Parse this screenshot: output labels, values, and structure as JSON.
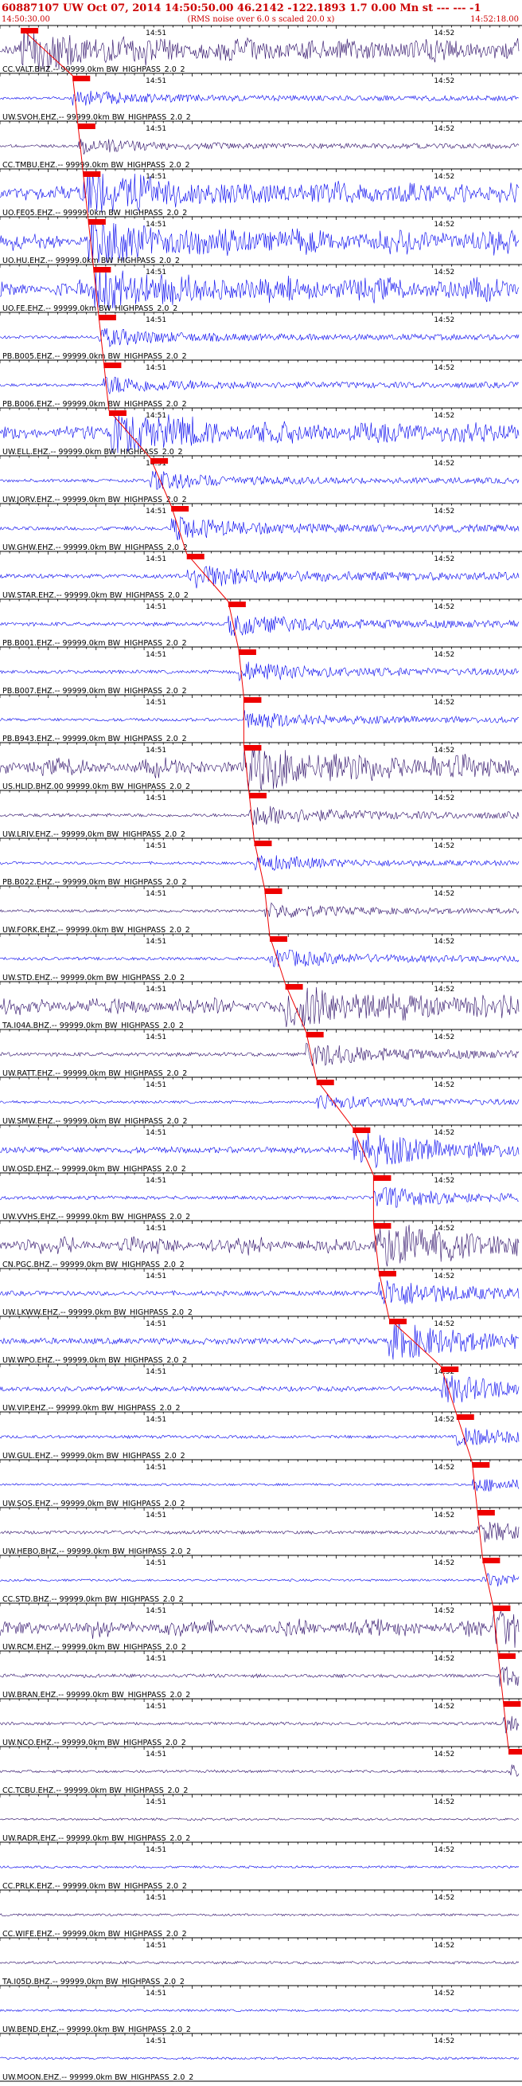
{
  "header": {
    "title": "60887107 UW Oct 07, 2014 14:50:50.00   46.2142 -122.1893  1.7 0.00 Mn st --- --- -1",
    "start_time": "14:50:30.00",
    "rms_note": "(RMS noise over 6.0 s scaled 20.0 x)",
    "end_time": "14:52:18.00"
  },
  "colors": {
    "trace_a": "#0000ee",
    "trace_b": "#2a0a66",
    "pick": "#ee0000",
    "axis": "#000000",
    "background": "#ffffff"
  },
  "chart_data": {
    "type": "line",
    "title": "60887107 UW Oct 07, 2014 14:50:50.00   46.2142 -122.1893  1.7 0.00 Mn st --- --- -1",
    "x_range": [
      "14:50:30.00",
      "14:52:18.00"
    ],
    "x_tick_labels": [
      "14:51",
      "14:52"
    ],
    "filter_note": "(RMS noise over 6.0 s scaled 20.0 x)",
    "series": [
      {
        "name": "CC.VALT.BHZ.--",
        "label": "CC.VALT.BHZ.-- 99999.0km BW_HIGHPASS_2.0_2",
        "pick": 0.04,
        "amp": 0.9,
        "color": "trace_b"
      },
      {
        "name": "UW.SVOH.EHZ.--",
        "label": "UW.SVOH.EHZ.-- 99999.0km BW_HIGHPASS_2.0_2",
        "pick": 0.14,
        "amp": 0.35,
        "color": "trace_a"
      },
      {
        "name": "CC.TMBU.EHZ.--",
        "label": "CC.TMBU.EHZ.-- 99999.0km BW_HIGHPASS_2.0_2",
        "pick": 0.15,
        "amp": 0.35,
        "color": "trace_b"
      },
      {
        "name": "UO.FE05.EHZ.--",
        "label": "UO.FE05.EHZ.-- 99999.0km BW_HIGHPASS_2.0_2",
        "pick": 0.16,
        "amp": 0.9,
        "color": "trace_a"
      },
      {
        "name": "UO.HU.EHZ.--",
        "label": "UO.HU.EHZ.-- 99999.0km BW_HIGHPASS_2.0_2",
        "pick": 0.17,
        "amp": 0.95,
        "color": "trace_a"
      },
      {
        "name": "UO.FE.EHZ.--",
        "label": "UO.FE.EHZ.-- 99999.0km BW_HIGHPASS_2.0_2",
        "pick": 0.18,
        "amp": 0.9,
        "color": "trace_a"
      },
      {
        "name": "PB.B005.EHZ.--",
        "label": "PB.B005.EHZ.-- 99999.0km BW_HIGHPASS_2.0_2",
        "pick": 0.19,
        "amp": 0.4,
        "color": "trace_a"
      },
      {
        "name": "PB.B006.EHZ.--",
        "label": "PB.B006.EHZ.-- 99999.0km BW_HIGHPASS_2.0_2",
        "pick": 0.2,
        "amp": 0.4,
        "color": "trace_a"
      },
      {
        "name": "UW.ELL.EHZ.--",
        "label": "UW.ELL.EHZ.-- 99999.0km BW_HIGHPASS_2.0_2",
        "pick": 0.21,
        "amp": 0.85,
        "color": "trace_a"
      },
      {
        "name": "UW.JORV.EHZ.--",
        "label": "UW.JORV.EHZ.-- 99999.0km BW_HIGHPASS_2.0_2",
        "pick": 0.29,
        "amp": 0.4,
        "color": "trace_a"
      },
      {
        "name": "UW.GHW.EHZ.--",
        "label": "UW.GHW.EHZ.-- 99999.0km BW_HIGHPASS_2.0_2",
        "pick": 0.33,
        "amp": 0.5,
        "color": "trace_a"
      },
      {
        "name": "UW.STAR.EHZ.--",
        "label": "UW.STAR.EHZ.-- 99999.0km BW_HIGHPASS_2.0_2",
        "pick": 0.36,
        "amp": 0.55,
        "color": "trace_a"
      },
      {
        "name": "PB.B001.EHZ.--",
        "label": "PB.B001.EHZ.-- 99999.0km BW_HIGHPASS_2.0_2",
        "pick": 0.44,
        "amp": 0.5,
        "color": "trace_a"
      },
      {
        "name": "PB.B007.EHZ.--",
        "label": "PB.B007.EHZ.-- 99999.0km BW_HIGHPASS_2.0_2",
        "pick": 0.46,
        "amp": 0.45,
        "color": "trace_a"
      },
      {
        "name": "PB.B943.EHZ.--",
        "label": "PB.B943.EHZ.-- 99999.0km BW_HIGHPASS_2.0_2",
        "pick": 0.47,
        "amp": 0.4,
        "color": "trace_a"
      },
      {
        "name": "US.HLID.BHZ.00",
        "label": "US.HLID.BHZ.00 99999.0km BW_HIGHPASS_2.0_2",
        "pick": 0.47,
        "amp": 0.95,
        "color": "trace_b"
      },
      {
        "name": "UW.LRIV.EHZ.--",
        "label": "UW.LRIV.EHZ.-- 99999.0km BW_HIGHPASS_2.0_2",
        "pick": 0.48,
        "amp": 0.45,
        "color": "trace_b"
      },
      {
        "name": "PB.B022.EHZ.--",
        "label": "PB.B022.EHZ.-- 99999.0km BW_HIGHPASS_2.0_2",
        "pick": 0.49,
        "amp": 0.35,
        "color": "trace_a"
      },
      {
        "name": "UW.FORK.EHZ.--",
        "label": "UW.FORK.EHZ.-- 99999.0km BW_HIGHPASS_2.0_2",
        "pick": 0.51,
        "amp": 0.35,
        "color": "trace_b"
      },
      {
        "name": "UW.STD.EHZ.--",
        "label": "UW.STD.EHZ.-- 99999.0km BW_HIGHPASS_2.0_2",
        "pick": 0.52,
        "amp": 0.4,
        "color": "trace_a"
      },
      {
        "name": "TA.I04A.BHZ.--",
        "label": "TA.I04A.BHZ.-- 99999.0km BW_HIGHPASS_2.0_2",
        "pick": 0.55,
        "amp": 0.9,
        "color": "trace_b"
      },
      {
        "name": "UW.RATT.EHZ.--",
        "label": "UW.RATT.EHZ.-- 99999.0km BW_HIGHPASS_2.0_2",
        "pick": 0.59,
        "amp": 0.5,
        "color": "trace_b"
      },
      {
        "name": "UW.SMW.EHZ.--",
        "label": "UW.SMW.EHZ.-- 99999.0km BW_HIGHPASS_2.0_2",
        "pick": 0.61,
        "amp": 0.35,
        "color": "trace_a"
      },
      {
        "name": "UW.OSD.EHZ.--",
        "label": "UW.OSD.EHZ.-- 99999.0km BW_HIGHPASS_2.0_2",
        "pick": 0.68,
        "amp": 0.8,
        "color": "trace_a"
      },
      {
        "name": "UW.VVHS.EHZ.--",
        "label": "UW.VVHS.EHZ.-- 99999.0km BW_HIGHPASS_2.0_2",
        "pick": 0.72,
        "amp": 0.45,
        "color": "trace_a"
      },
      {
        "name": "CN.PGC.BHZ.--",
        "label": "CN.PGC.BHZ.-- 99999.0km BW_HIGHPASS_2.0_2",
        "pick": 0.72,
        "amp": 0.9,
        "color": "trace_b"
      },
      {
        "name": "UW.LKWW.EHZ.--",
        "label": "UW.LKWW.EHZ.-- 99999.0km BW_HIGHPASS_2.0_2",
        "pick": 0.73,
        "amp": 0.6,
        "color": "trace_a"
      },
      {
        "name": "UW.WPO.EHZ.--",
        "label": "UW.WPO.EHZ.-- 99999.0km BW_HIGHPASS_2.0_2",
        "pick": 0.75,
        "amp": 0.8,
        "color": "trace_a"
      },
      {
        "name": "UW.VIP.EHZ.--",
        "label": "UW.VIP.EHZ.-- 99999.0km BW_HIGHPASS_2.0_2",
        "pick": 0.85,
        "amp": 0.6,
        "color": "trace_a"
      },
      {
        "name": "UW.GUL.EHZ.--",
        "label": "UW.GUL.EHZ.-- 99999.0km BW_HIGHPASS_2.0_2",
        "pick": 0.88,
        "amp": 0.4,
        "color": "trace_a"
      },
      {
        "name": "UW.SOS.EHZ.--",
        "label": "UW.SOS.EHZ.-- 99999.0km BW_HIGHPASS_2.0_2",
        "pick": 0.91,
        "amp": 0.3,
        "color": "trace_a"
      },
      {
        "name": "UW.HEBO.BHZ.--",
        "label": "UW.HEBO.BHZ.-- 99999.0km BW_HIGHPASS_2.0_2",
        "pick": 0.92,
        "amp": 0.45,
        "color": "trace_b"
      },
      {
        "name": "CC.STD.BHZ.--",
        "label": "CC.STD.BHZ.-- 99999.0km BW_HIGHPASS_2.0_2",
        "pick": 0.93,
        "amp": 0.3,
        "color": "trace_a"
      },
      {
        "name": "UW.RCM.EHZ.--",
        "label": "UW.RCM.EHZ.-- 99999.0km BW_HIGHPASS_2.0_2",
        "pick": 0.95,
        "amp": 0.9,
        "color": "trace_b"
      },
      {
        "name": "UW.BRAN.EHZ.--",
        "label": "UW.BRAN.EHZ.-- 99999.0km BW_HIGHPASS_2.0_2",
        "pick": 0.96,
        "amp": 0.45,
        "color": "trace_b"
      },
      {
        "name": "UW.NCO.EHZ.--",
        "label": "UW.NCO.EHZ.-- 99999.0km BW_HIGHPASS_2.0_2",
        "pick": 0.97,
        "amp": 0.4,
        "color": "trace_b"
      },
      {
        "name": "CC.TCBU.EHZ.--",
        "label": "CC.TCBU.EHZ.-- 99999.0km BW_HIGHPASS_2.0_2",
        "pick": 0.98,
        "amp": 0.35,
        "color": "trace_b"
      },
      {
        "name": "UW.RADR.EHZ.--",
        "label": "UW.RADR.EHZ.-- 99999.0km BW_HIGHPASS_2.0_2",
        "pick": null,
        "amp": 0.3,
        "color": "trace_b"
      },
      {
        "name": "CC.PRLK.EHZ.--",
        "label": "CC.PRLK.EHZ.-- 99999.0km BW_HIGHPASS_2.0_2",
        "pick": null,
        "amp": 0.3,
        "color": "trace_a"
      },
      {
        "name": "CC.WIFE.EHZ.--",
        "label": "CC.WIFE.EHZ.-- 99999.0km BW_HIGHPASS_2.0_2",
        "pick": null,
        "amp": 0.3,
        "color": "trace_b"
      },
      {
        "name": "TA.I05D.BHZ.--",
        "label": "TA.I05D.BHZ.-- 99999.0km BW_HIGHPASS_2.0_2",
        "pick": null,
        "amp": 0.35,
        "color": "trace_b"
      },
      {
        "name": "UW.BEND.EHZ.--",
        "label": "UW.BEND.EHZ.-- 99999.0km BW_HIGHPASS_2.0_2",
        "pick": null,
        "amp": 0.3,
        "color": "trace_a"
      },
      {
        "name": "UW.MOON.EHZ.--",
        "label": "UW.MOON.EHZ.-- 99999.0km BW_HIGHPASS_2.0_2",
        "pick": null,
        "amp": 0.3,
        "color": "trace_a"
      }
    ]
  }
}
